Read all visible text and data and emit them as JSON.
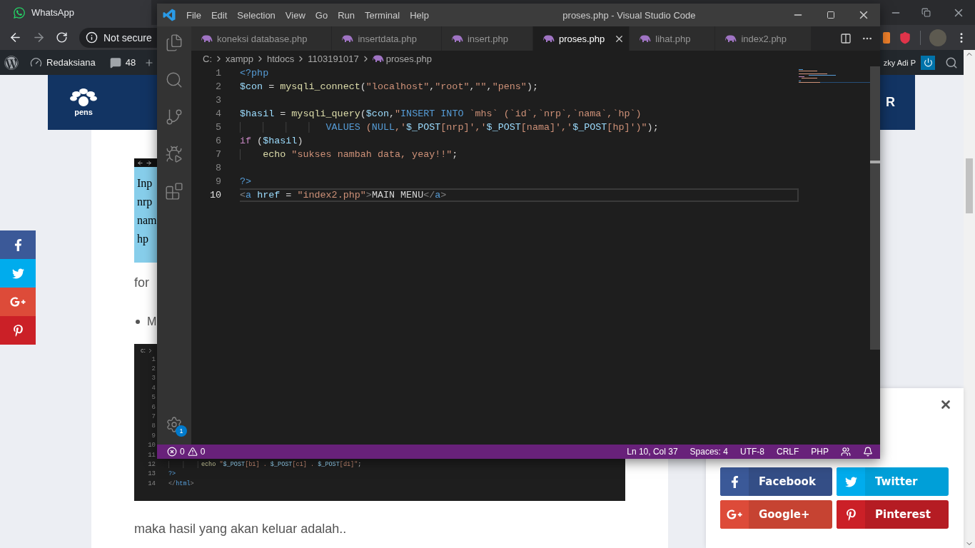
{
  "browser": {
    "tab_title": "WhatsApp",
    "security_label": "Not secure"
  },
  "admin_bar": {
    "site_name": "Redaksiana",
    "comment_count": "48",
    "user_name": "zky Adi P"
  },
  "page": {
    "logo_text": "pens",
    "header_text": "R",
    "screenshot_lines": [
      "Inp",
      "nrp",
      "nam",
      "hp"
    ],
    "paragraph_1": "for",
    "bullets": [
      "M"
    ],
    "code_breadcrumb": "c:",
    "code_lines": [
      {
        "number": "1"
      },
      {
        "number": "2"
      },
      {
        "number": "3"
      },
      {
        "number": "4"
      },
      {
        "number": "5"
      },
      {
        "number": "6"
      },
      {
        "number": "7"
      },
      {
        "number": "8"
      },
      {
        "number": "9"
      },
      {
        "number": "10"
      },
      {
        "number": "11"
      },
      {
        "number": "12",
        "tokens": [
          {
            "kind": "fn",
            "text": "         echo"
          },
          {
            "kind": "str",
            "text": " \""
          },
          {
            "kind": "var",
            "text": "$_POST"
          },
          {
            "kind": "str",
            "text": "[b1] . "
          },
          {
            "kind": "var",
            "text": "$_POST"
          },
          {
            "kind": "str",
            "text": "[c1] . "
          },
          {
            "kind": "var",
            "text": "$_POST"
          },
          {
            "kind": "str",
            "text": "[d1]\""
          },
          {
            "kind": "plain",
            "text": ";"
          }
        ]
      },
      {
        "number": "13",
        "tokens": [
          {
            "kind": "tag",
            "text": "?>"
          }
        ]
      },
      {
        "number": "14",
        "tokens": [
          {
            "kind": "bracket",
            "text": "</"
          },
          {
            "kind": "htag",
            "text": "html"
          },
          {
            "kind": "bracket",
            "text": ">"
          }
        ]
      }
    ],
    "paragraph_2": "maka hasil yang akan keluar adalah.."
  },
  "share_rail": [
    {
      "kind": "facebook"
    },
    {
      "kind": "twitter"
    },
    {
      "kind": "google"
    },
    {
      "kind": "pinterest"
    }
  ],
  "share_popup": {
    "buttons": [
      {
        "kind": "facebook",
        "label": "Facebook"
      },
      {
        "kind": "twitter",
        "label": "Twitter"
      },
      {
        "kind": "google",
        "label": "Google+"
      },
      {
        "kind": "pinterest",
        "label": "Pinterest"
      }
    ]
  },
  "editor": {
    "title": "proses.php - Visual Studio Code",
    "menu": [
      "File",
      "Edit",
      "Selection",
      "View",
      "Go",
      "Run",
      "Terminal",
      "Help"
    ],
    "activity_items": [
      {
        "kind": "files"
      },
      {
        "kind": "search"
      },
      {
        "kind": "source-control"
      },
      {
        "kind": "run"
      },
      {
        "kind": "extensions"
      }
    ],
    "settings_badge": "1",
    "tabs": [
      {
        "label": "koneksi database.php",
        "selected": false
      },
      {
        "label": "insertdata.php",
        "selected": false
      },
      {
        "label": "insert.php",
        "selected": false
      },
      {
        "label": "proses.php",
        "selected": true
      },
      {
        "label": "lihat.php",
        "selected": false
      },
      {
        "label": "index2.php",
        "selected": false
      }
    ],
    "breadcrumb": [
      "C:",
      "xampp",
      "htdocs",
      "1103191017",
      "proses.php"
    ],
    "lines": [
      {
        "number": "1",
        "current": false,
        "tokens": [
          {
            "kind": "tag",
            "text": "<?php"
          }
        ]
      },
      {
        "number": "2",
        "current": false,
        "tokens": [
          {
            "kind": "var",
            "text": "$con"
          },
          {
            "kind": "plain",
            "text": " = "
          },
          {
            "kind": "fn",
            "text": "mysqli_connect"
          },
          {
            "kind": "plain",
            "text": "("
          },
          {
            "kind": "str",
            "text": "\"localhost\""
          },
          {
            "kind": "plain",
            "text": ","
          },
          {
            "kind": "str",
            "text": "\"root\""
          },
          {
            "kind": "plain",
            "text": ","
          },
          {
            "kind": "str",
            "text": "\"\""
          },
          {
            "kind": "plain",
            "text": ","
          },
          {
            "kind": "str",
            "text": "\"pens\""
          },
          {
            "kind": "plain",
            "text": ");"
          }
        ]
      },
      {
        "number": "3",
        "current": false
      },
      {
        "number": "4",
        "current": false,
        "tokens": [
          {
            "kind": "var",
            "text": "$hasil"
          },
          {
            "kind": "plain",
            "text": " = "
          },
          {
            "kind": "fn",
            "text": "mysqli_query"
          },
          {
            "kind": "plain",
            "text": "("
          },
          {
            "kind": "var",
            "text": "$con"
          },
          {
            "kind": "plain",
            "text": ","
          },
          {
            "kind": "str",
            "text": "\""
          },
          {
            "kind": "sql",
            "text": "INSERT INTO"
          },
          {
            "kind": "str",
            "text": " `mhs` (`id`,`nrp`,`nama`,`hp`)"
          }
        ]
      },
      {
        "number": "5",
        "current": false,
        "tokens": [
          {
            "kind": "sql",
            "text": "               VALUES"
          },
          {
            "kind": "str",
            "text": " ("
          },
          {
            "kind": "sql",
            "text": "NULL"
          },
          {
            "kind": "str",
            "text": ",'"
          },
          {
            "kind": "var",
            "text": "$_POST"
          },
          {
            "kind": "str",
            "text": "[nrp]','"
          },
          {
            "kind": "var",
            "text": "$_POST"
          },
          {
            "kind": "str",
            "text": "[nama]','"
          },
          {
            "kind": "var",
            "text": "$_POST"
          },
          {
            "kind": "str",
            "text": "[hp]')\""
          },
          {
            "kind": "plain",
            "text": ");"
          }
        ]
      },
      {
        "number": "6",
        "current": false,
        "tokens": [
          {
            "kind": "kw",
            "text": "if"
          },
          {
            "kind": "plain",
            "text": " ("
          },
          {
            "kind": "var",
            "text": "$hasil"
          },
          {
            "kind": "plain",
            "text": ")"
          }
        ]
      },
      {
        "number": "7",
        "current": false,
        "tokens": [
          {
            "kind": "fn",
            "text": "    echo"
          },
          {
            "kind": "str",
            "text": " \"sukses nambah data, yeay!!\""
          },
          {
            "kind": "plain",
            "text": ";"
          }
        ]
      },
      {
        "number": "8",
        "current": false
      },
      {
        "number": "9",
        "current": false,
        "tokens": [
          {
            "kind": "tag",
            "text": "?>"
          }
        ]
      },
      {
        "number": "10",
        "current": true,
        "tokens": [
          {
            "kind": "bracket",
            "text": "<"
          },
          {
            "kind": "htag",
            "text": "a"
          },
          {
            "kind": "attr",
            "text": " href"
          },
          {
            "kind": "plain",
            "text": " = "
          },
          {
            "kind": "str",
            "text": "\"index2.php\""
          },
          {
            "kind": "bracket",
            "text": ">"
          },
          {
            "kind": "plain",
            "text": "MAIN MENU"
          },
          {
            "kind": "bracket",
            "text": "</"
          },
          {
            "kind": "htag",
            "text": "a"
          },
          {
            "kind": "bracket",
            "text": ">"
          }
        ]
      }
    ],
    "status": {
      "errors": "0",
      "warnings": "0",
      "items": [
        "Ln 10, Col 37",
        "Spaces: 4",
        "UTF-8",
        "CRLF",
        "PHP"
      ]
    }
  }
}
